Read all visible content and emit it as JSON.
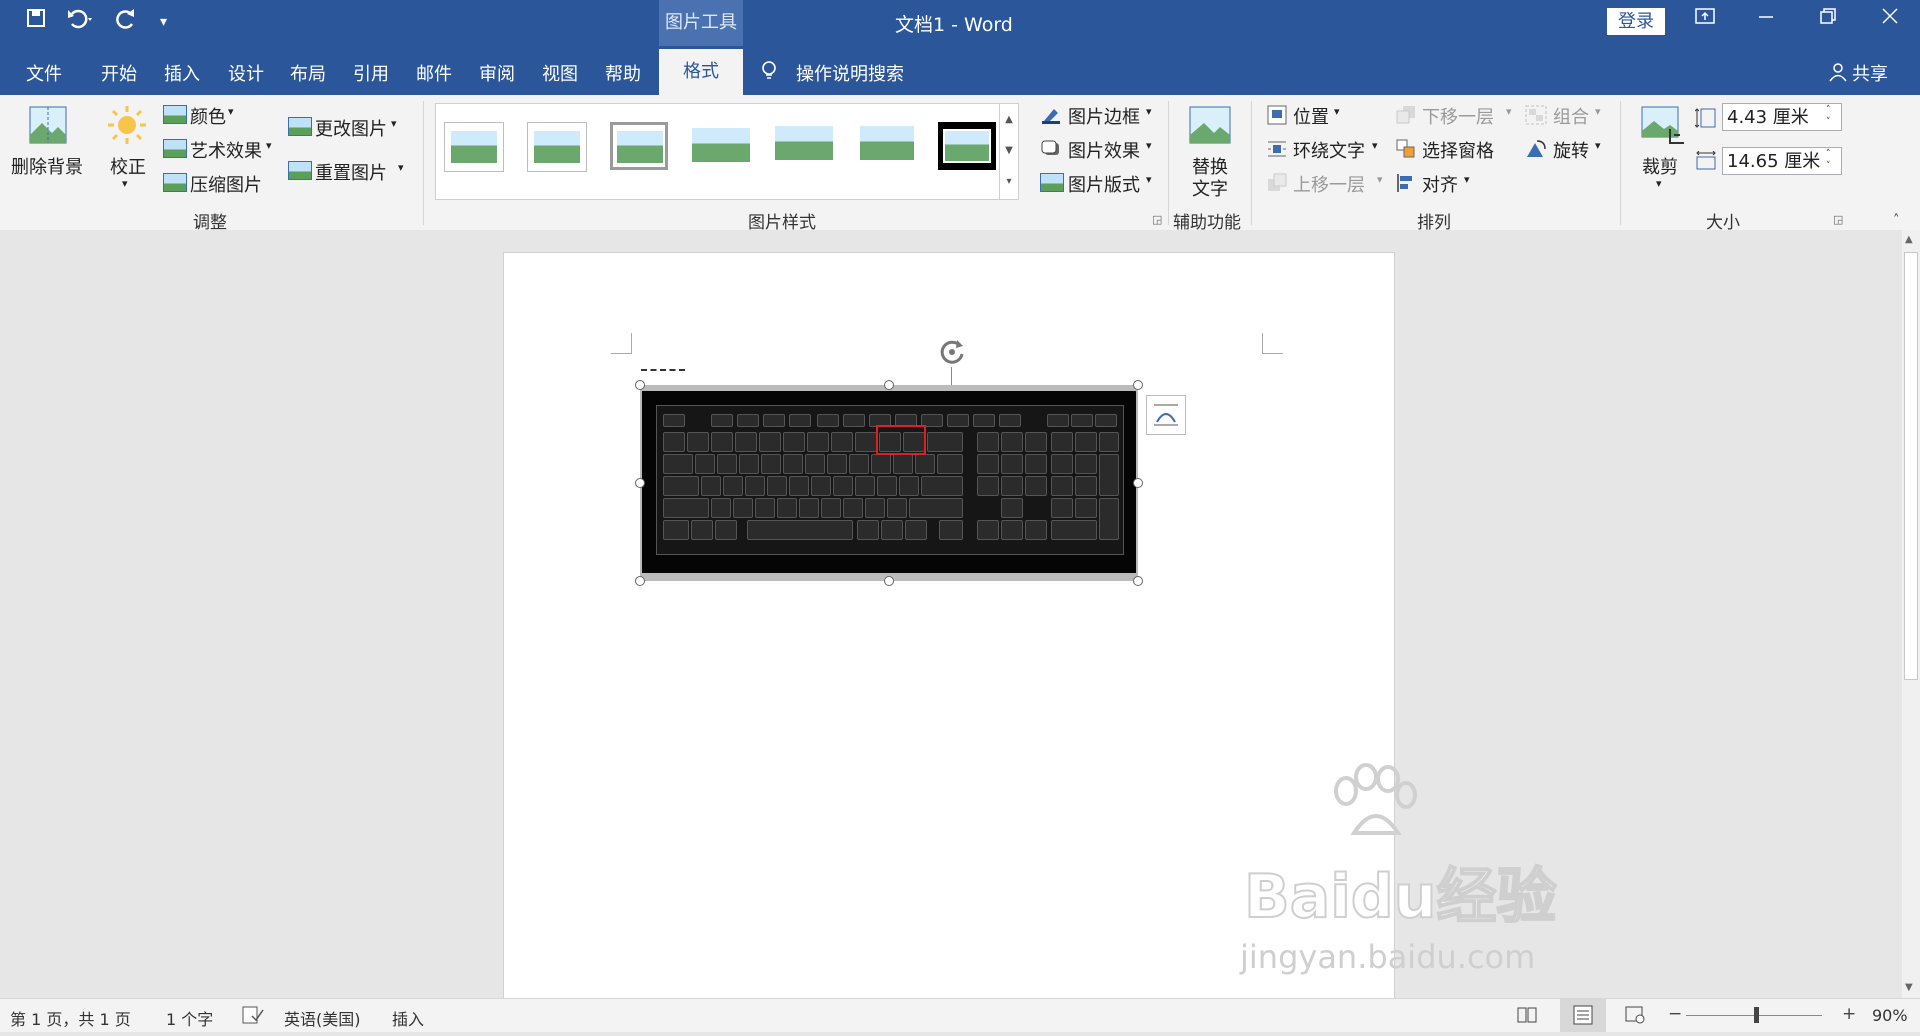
{
  "titlebar": {
    "tool_context": "图片工具",
    "doc_title": "文档1 - Word",
    "login": "登录"
  },
  "tabs": [
    {
      "label": "文件"
    },
    {
      "label": "开始"
    },
    {
      "label": "插入"
    },
    {
      "label": "设计"
    },
    {
      "label": "布局"
    },
    {
      "label": "引用"
    },
    {
      "label": "邮件"
    },
    {
      "label": "审阅"
    },
    {
      "label": "视图"
    },
    {
      "label": "帮助"
    }
  ],
  "active_tab": "格式",
  "tell_me": "操作说明搜索",
  "share": "共享",
  "ribbon": {
    "remove_bg": "删除背景",
    "correct": "校正",
    "color": "颜色",
    "art_effect": "艺术效果",
    "compress": "压缩图片",
    "change_pic": "更改图片",
    "reset_pic": "重置图片",
    "group_adjust": "调整",
    "group_styles": "图片样式",
    "pic_border": "图片边框",
    "pic_effect": "图片效果",
    "pic_layout": "图片版式",
    "alt_text_1": "替换",
    "alt_text_2": "文字",
    "group_access": "辅助功能",
    "position": "位置",
    "wrap_text": "环绕文字",
    "bring_forward": "上移一层",
    "send_backward": "下移一层",
    "selection_pane": "选择窗格",
    "align": "对齐",
    "group_obj": "组合",
    "rotate": "旋转",
    "group_arrange": "排列",
    "crop": "裁剪",
    "height": "4.43 厘米",
    "width": "14.65 厘米",
    "group_size": "大小"
  },
  "status": {
    "page": "第 1 页，共 1 页",
    "words": "1 个字",
    "lang": "英语(美国)",
    "mode": "插入",
    "zoom": "90%"
  },
  "watermark": {
    "brand": "Baidu经验",
    "url": "jingyan.baidu.com"
  },
  "colors": {
    "brand_blue": "#2b579a",
    "highlight_red": "#e02020"
  }
}
